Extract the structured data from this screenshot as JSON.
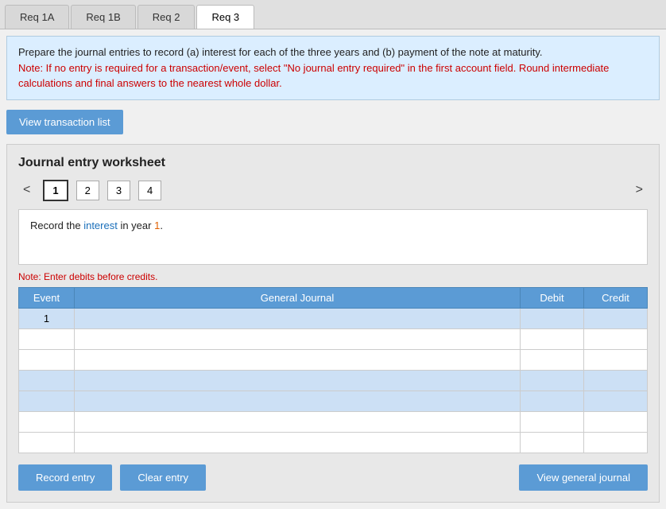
{
  "tabs": [
    {
      "id": "req1a",
      "label": "Req 1A",
      "active": false
    },
    {
      "id": "req1b",
      "label": "Req 1B",
      "active": false
    },
    {
      "id": "req2",
      "label": "Req 2",
      "active": false
    },
    {
      "id": "req3",
      "label": "Req 3",
      "active": true
    }
  ],
  "instruction": {
    "main": "Prepare the journal entries to record (a) interest for each of the three years and (b) payment of the note at maturity.",
    "note": "Note: If no entry is required for a transaction/event, select \"No journal entry required\" in the first account field. Round intermediate calculations and final answers to the nearest whole dollar."
  },
  "view_transaction_btn": "View transaction list",
  "worksheet": {
    "title": "Journal entry worksheet",
    "pages": [
      "1",
      "2",
      "3",
      "4"
    ],
    "active_page": "1",
    "nav_prev": "<",
    "nav_next": ">",
    "record_desc": "Record the interest in year 1.",
    "note_enter": "Note: Enter debits before credits.",
    "table": {
      "columns": [
        "Event",
        "General Journal",
        "Debit",
        "Credit"
      ],
      "rows": [
        {
          "event": "1",
          "journal": "",
          "debit": "",
          "credit": "",
          "shaded": true
        },
        {
          "event": "",
          "journal": "",
          "debit": "",
          "credit": "",
          "shaded": false
        },
        {
          "event": "",
          "journal": "",
          "debit": "",
          "credit": "",
          "shaded": false
        },
        {
          "event": "",
          "journal": "",
          "debit": "",
          "credit": "",
          "shaded": true
        },
        {
          "event": "",
          "journal": "",
          "debit": "",
          "credit": "",
          "shaded": true
        },
        {
          "event": "",
          "journal": "",
          "debit": "",
          "credit": "",
          "shaded": false
        },
        {
          "event": "",
          "journal": "",
          "debit": "",
          "credit": "",
          "shaded": false
        }
      ]
    }
  },
  "buttons": {
    "record_entry": "Record entry",
    "clear_entry": "Clear entry",
    "view_general_journal": "View general journal"
  }
}
